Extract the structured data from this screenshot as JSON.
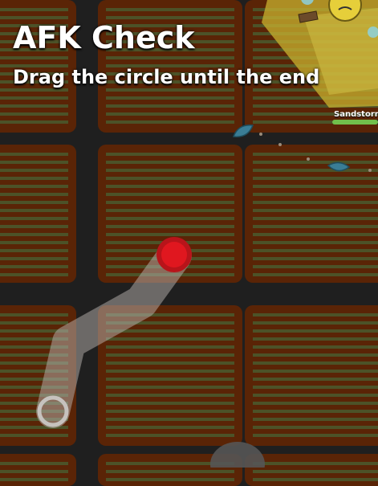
{
  "afk_check": {
    "title": "AFK Check",
    "subtitle": "Drag the circle until the end"
  },
  "mob": {
    "name": "Sandstorm",
    "health_fraction": 0.95
  },
  "colors": {
    "soil": "#5a2406",
    "crop_rows": "#4a5a2e",
    "path_line": "#1f1f1f",
    "drag_handle": "#e0171f",
    "sandstorm": "#c9b12f",
    "leaf": "#3a7d95"
  },
  "icons": {
    "drag_handle": "red-circle",
    "path_end": "hollow-ring",
    "petals": "leaf-icon"
  }
}
